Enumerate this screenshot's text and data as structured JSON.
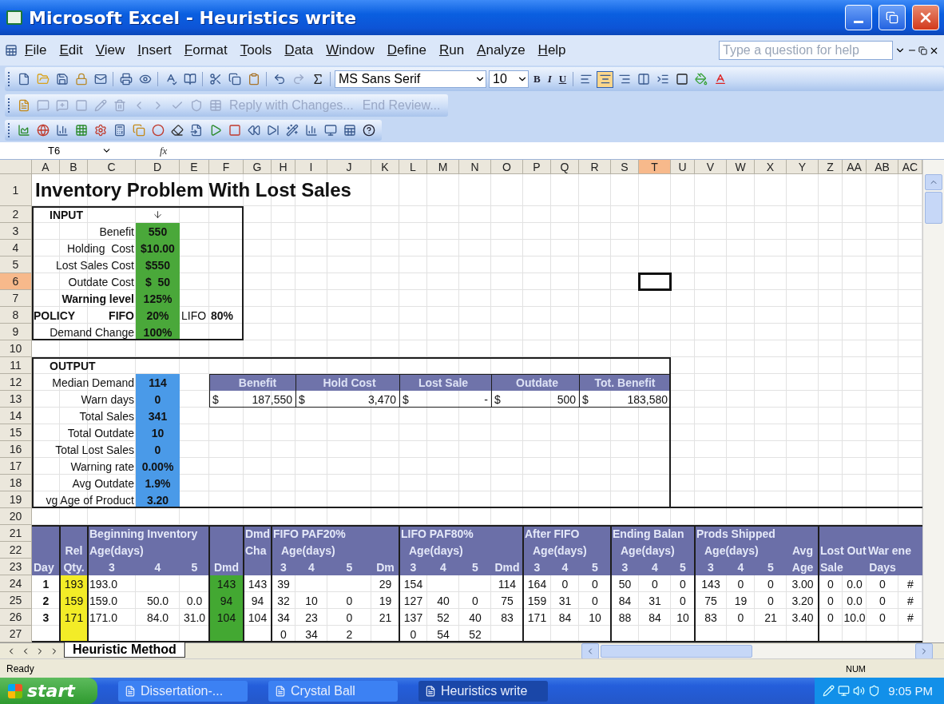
{
  "window": {
    "title": "Microsoft Excel - Heuristics write"
  },
  "menu": [
    "File",
    "Edit",
    "View",
    "Insert",
    "Format",
    "Tools",
    "Data",
    "Window",
    "Define",
    "Run",
    "Analyze",
    "Help"
  ],
  "help_box": {
    "placeholder": "Type a question for help"
  },
  "font_toolbar": {
    "font": "MS Sans Serif",
    "size": "10",
    "styles": [
      "B",
      "I",
      "U"
    ]
  },
  "review_toolbar": {
    "items": [
      "Reply with Changes...",
      "End Review..."
    ]
  },
  "formula_bar": {
    "cell": "T6",
    "function_label": "fx"
  },
  "columns": [
    {
      "label": "A",
      "selected": false
    },
    {
      "label": "B",
      "selected": false
    },
    {
      "label": "C",
      "selected": false
    },
    {
      "label": "D",
      "selected": false
    },
    {
      "label": "E",
      "selected": false
    },
    {
      "label": "F",
      "selected": false
    },
    {
      "label": "G",
      "selected": false
    },
    {
      "label": "H",
      "selected": false
    },
    {
      "label": "I",
      "selected": false
    },
    {
      "label": "J",
      "selected": false
    },
    {
      "label": "K",
      "selected": false
    },
    {
      "label": "L",
      "selected": false
    },
    {
      "label": "M",
      "selected": false
    },
    {
      "label": "N",
      "selected": false
    },
    {
      "label": "O",
      "selected": false
    },
    {
      "label": "P",
      "selected": false
    },
    {
      "label": "Q",
      "selected": false
    },
    {
      "label": "R",
      "selected": false
    },
    {
      "label": "S",
      "selected": false
    },
    {
      "label": "T",
      "selected": true
    },
    {
      "label": "U",
      "selected": false
    },
    {
      "label": "V",
      "selected": false
    },
    {
      "label": "W",
      "selected": false
    },
    {
      "label": "X",
      "selected": false
    },
    {
      "label": "Y",
      "selected": false
    },
    {
      "label": "Z",
      "selected": false
    },
    {
      "label": "AA",
      "selected": false
    },
    {
      "label": "AB",
      "selected": false
    },
    {
      "label": "AC",
      "selected": false
    }
  ],
  "rows": [
    {
      "label": "1",
      "selected": false,
      "kind": "plain",
      "cells": {
        "A": {
          "text": "Inventory Problem With Lost Sales",
          "kind": "title"
        }
      }
    },
    {
      "label": "2",
      "selected": false,
      "kind": "plain",
      "cells": {
        "A": {
          "text": "INPUT",
          "kind": "heading"
        },
        "D": {
          "kind": "marker"
        }
      }
    },
    {
      "label": "3",
      "selected": false,
      "kind": "plain",
      "cells": {
        "C": {
          "text": "Benefit",
          "kind": "label"
        },
        "D": {
          "text": "550",
          "kind": "input"
        }
      }
    },
    {
      "label": "4",
      "selected": false,
      "kind": "plain",
      "cells": {
        "C": {
          "text": "Holding  Cost",
          "kind": "label"
        },
        "D": {
          "text": "$10.00",
          "kind": "input"
        }
      }
    },
    {
      "label": "5",
      "selected": false,
      "kind": "plain",
      "cells": {
        "C": {
          "text": "Lost Sales Cost",
          "kind": "label"
        },
        "D": {
          "text": "$550",
          "kind": "input"
        }
      }
    },
    {
      "label": "6",
      "selected": true,
      "kind": "plain",
      "cells": {
        "C": {
          "text": "Outdate Cost",
          "kind": "label"
        },
        "D": {
          "text": "$  50",
          "kind": "input"
        }
      }
    },
    {
      "label": "7",
      "selected": false,
      "kind": "plain",
      "cells": {
        "C": {
          "text": "Warning level",
          "kind": "label-bold"
        },
        "D": {
          "text": "125%",
          "kind": "input"
        }
      }
    },
    {
      "label": "8",
      "selected": false,
      "kind": "plain",
      "cells": {
        "A": {
          "text": "POLICY",
          "kind": "policy"
        },
        "C": {
          "text": "FIFO",
          "kind": "label-bold"
        },
        "D": {
          "text": "20%",
          "kind": "input"
        },
        "E": {
          "text": "LIFO",
          "kind": "text"
        },
        "F": {
          "text": "80%",
          "kind": "bold"
        }
      }
    },
    {
      "label": "9",
      "selected": false,
      "kind": "plain",
      "cells": {
        "C": {
          "text": "Demand Change",
          "kind": "label"
        },
        "D": {
          "text": "100%",
          "kind": "input"
        }
      }
    },
    {
      "label": "10",
      "selected": false,
      "kind": "plain",
      "cells": {}
    },
    {
      "label": "11",
      "selected": false,
      "kind": "plain",
      "cells": {
        "A": {
          "text": "OUTPUT",
          "kind": "heading"
        }
      }
    },
    {
      "label": "12",
      "selected": false,
      "kind": "plain",
      "cells": {
        "C": {
          "text": "Median Demand",
          "kind": "label"
        },
        "D": {
          "text": "114",
          "kind": "output"
        },
        "G": {
          "text": "Benefit",
          "kind": "sum-head"
        },
        "J": {
          "text": "Hold Cost",
          "kind": "sum-head"
        },
        "M": {
          "text": "Lost Sale",
          "kind": "sum-head"
        },
        "P": {
          "text": "Outdate",
          "kind": "sum-head"
        },
        "S": {
          "text": "Tot. Benefit",
          "kind": "sum-head"
        }
      }
    },
    {
      "label": "13",
      "selected": false,
      "kind": "plain",
      "cells": {
        "C": {
          "text": "Warn days",
          "kind": "label"
        },
        "D": {
          "text": "0",
          "kind": "output"
        },
        "F": {
          "text": "$",
          "kind": "currency"
        },
        "H": {
          "text": "187,550",
          "kind": "amount"
        },
        "I": {
          "text": "$",
          "kind": "currency"
        },
        "K": {
          "text": "3,470",
          "kind": "amount"
        },
        "L": {
          "text": "$",
          "kind": "currency"
        },
        "N": {
          "text": "-",
          "kind": "amount"
        },
        "O": {
          "text": "$",
          "kind": "currency"
        },
        "Q": {
          "text": "500",
          "kind": "amount"
        },
        "R": {
          "text": "$",
          "kind": "currency"
        },
        "T": {
          "text": "183,580",
          "kind": "amount"
        }
      }
    },
    {
      "label": "14",
      "selected": false,
      "kind": "plain",
      "cells": {
        "C": {
          "text": "Total Sales",
          "kind": "label"
        },
        "D": {
          "text": "341",
          "kind": "output"
        }
      }
    },
    {
      "label": "15",
      "selected": false,
      "kind": "plain",
      "cells": {
        "C": {
          "text": "Total Outdate",
          "kind": "label"
        },
        "D": {
          "text": "10",
          "kind": "output"
        }
      }
    },
    {
      "label": "16",
      "selected": false,
      "kind": "plain",
      "cells": {
        "C": {
          "text": "Total Lost Sales",
          "kind": "label"
        },
        "D": {
          "text": "0",
          "kind": "output"
        }
      }
    },
    {
      "label": "17",
      "selected": false,
      "kind": "plain",
      "cells": {
        "C": {
          "text": "Warning rate",
          "kind": "label"
        },
        "D": {
          "text": "0.00%",
          "kind": "output"
        }
      }
    },
    {
      "label": "18",
      "selected": false,
      "kind": "plain",
      "cells": {
        "C": {
          "text": "Avg Outdate",
          "kind": "label"
        },
        "D": {
          "text": "1.9%",
          "kind": "output"
        }
      }
    },
    {
      "label": "19",
      "selected": false,
      "kind": "plain",
      "cells": {
        "C": {
          "text": "vg Age of Product",
          "kind": "label"
        },
        "D": {
          "text": "3.20",
          "kind": "output"
        }
      }
    },
    {
      "label": "20",
      "selected": false,
      "kind": "plain",
      "cells": {}
    },
    {
      "label": "21",
      "selected": false,
      "kind": "band",
      "cells": {
        "C": {
          "text": "Beginning Inventory",
          "kind": "head"
        },
        "G": {
          "text": "Dmd",
          "kind": "head"
        },
        "H": {
          "text": "FIFO PAF20%",
          "kind": "head"
        },
        "L": {
          "text": "LIFO PAF80%",
          "kind": "head"
        },
        "P": {
          "text": "After FIFO",
          "kind": "head"
        },
        "S": {
          "text": "Ending Balan",
          "kind": "head"
        },
        "V": {
          "text": "Prods Shipped",
          "kind": "head"
        }
      }
    },
    {
      "label": "22",
      "selected": false,
      "kind": "band",
      "cells": {
        "B": {
          "text": "Rel",
          "kind": "head-c"
        },
        "C": {
          "text": "Age(days)",
          "kind": "head"
        },
        "G": {
          "text": "Cha",
          "kind": "head"
        },
        "H": {
          "text": "Age(days)",
          "kind": "head-in"
        },
        "L": {
          "text": "Age(days)",
          "kind": "head-in"
        },
        "P": {
          "text": "Age(days)",
          "kind": "head-in"
        },
        "S": {
          "text": "Age(days)",
          "kind": "head-in"
        },
        "V": {
          "text": "Age(days)",
          "kind": "head-in"
        },
        "Y": {
          "text": "Avg",
          "kind": "head-c"
        },
        "Z": {
          "text": "Lost Out",
          "kind": "head"
        },
        "AB": {
          "text": "War ene",
          "kind": "head"
        }
      }
    },
    {
      "label": "23",
      "selected": false,
      "kind": "band",
      "cells": {
        "A": {
          "text": "Day",
          "kind": "head"
        },
        "B": {
          "text": "Qty.",
          "kind": "head-c"
        },
        "C": {
          "text": "3",
          "kind": "head-c"
        },
        "D": {
          "text": "4",
          "kind": "head-c"
        },
        "E": {
          "text": "5",
          "kind": "head-c"
        },
        "F": {
          "text": "Dmd",
          "kind": "head-c"
        },
        "H": {
          "text": "3",
          "kind": "head-c"
        },
        "I": {
          "text": "4",
          "kind": "head-c"
        },
        "J": {
          "text": "5",
          "kind": "head-c"
        },
        "K": {
          "text": "Dm",
          "kind": "head-c"
        },
        "L": {
          "text": "3",
          "kind": "head-c"
        },
        "M": {
          "text": "4",
          "kind": "head-c"
        },
        "N": {
          "text": "5",
          "kind": "head-c"
        },
        "O": {
          "text": "Dmd",
          "kind": "head-c"
        },
        "P": {
          "text": "3",
          "kind": "head-c"
        },
        "Q": {
          "text": "4",
          "kind": "head-c"
        },
        "R": {
          "text": "5",
          "kind": "head-c"
        },
        "S": {
          "text": "3",
          "kind": "head-c"
        },
        "T": {
          "text": "4",
          "kind": "head-c"
        },
        "U": {
          "text": "5",
          "kind": "head-c"
        },
        "V": {
          "text": "3",
          "kind": "head-c"
        },
        "W": {
          "text": "4",
          "kind": "head-c"
        },
        "X": {
          "text": "5",
          "kind": "head-c"
        },
        "Y": {
          "text": "Age",
          "kind": "head-c"
        },
        "Z": {
          "text": "Sale",
          "kind": "head"
        },
        "AB": {
          "text": "Days",
          "kind": "head-c"
        }
      }
    },
    {
      "label": "24",
      "selected": false,
      "kind": "plain",
      "cells": {
        "A": {
          "text": "1",
          "kind": "day"
        },
        "B": {
          "text": "193",
          "kind": "release"
        },
        "C": {
          "text": "193.0",
          "kind": "num-l"
        },
        "F": {
          "text": "143",
          "kind": "demand"
        },
        "G": {
          "text": "143",
          "kind": "num"
        },
        "H": {
          "text": "39",
          "kind": "num"
        },
        "K": {
          "text": "29",
          "kind": "num"
        },
        "L": {
          "text": "154",
          "kind": "num"
        },
        "O": {
          "text": "114",
          "kind": "num"
        },
        "P": {
          "text": "164",
          "kind": "num"
        },
        "Q": {
          "text": "0",
          "kind": "num"
        },
        "R": {
          "text": "0",
          "kind": "num"
        },
        "S": {
          "text": "50",
          "kind": "num"
        },
        "T": {
          "text": "0",
          "kind": "num"
        },
        "U": {
          "text": "0",
          "kind": "num"
        },
        "V": {
          "text": "143",
          "kind": "num"
        },
        "W": {
          "text": "0",
          "kind": "num"
        },
        "X": {
          "text": "0",
          "kind": "num"
        },
        "Y": {
          "text": "3.00",
          "kind": "num"
        },
        "Z": {
          "text": "0",
          "kind": "num"
        },
        "AA": {
          "text": "0.0",
          "kind": "num"
        },
        "AB": {
          "text": "0",
          "kind": "num"
        },
        "AC": {
          "text": "#",
          "kind": "num"
        }
      }
    },
    {
      "label": "25",
      "selected": false,
      "kind": "plain",
      "cells": {
        "A": {
          "text": "2",
          "kind": "day"
        },
        "B": {
          "text": "159",
          "kind": "release"
        },
        "C": {
          "text": "159.0",
          "kind": "num-l"
        },
        "D": {
          "text": "50.0",
          "kind": "num"
        },
        "E": {
          "text": "0.0",
          "kind": "num"
        },
        "F": {
          "text": "94",
          "kind": "demand"
        },
        "G": {
          "text": "94",
          "kind": "num"
        },
        "H": {
          "text": "32",
          "kind": "num"
        },
        "I": {
          "text": "10",
          "kind": "num"
        },
        "J": {
          "text": "0",
          "kind": "num"
        },
        "K": {
          "text": "19",
          "kind": "num"
        },
        "L": {
          "text": "127",
          "kind": "num"
        },
        "M": {
          "text": "40",
          "kind": "num"
        },
        "N": {
          "text": "0",
          "kind": "num"
        },
        "O": {
          "text": "75",
          "kind": "num"
        },
        "P": {
          "text": "159",
          "kind": "num"
        },
        "Q": {
          "text": "31",
          "kind": "num"
        },
        "R": {
          "text": "0",
          "kind": "num"
        },
        "S": {
          "text": "84",
          "kind": "num"
        },
        "T": {
          "text": "31",
          "kind": "num"
        },
        "U": {
          "text": "0",
          "kind": "num"
        },
        "V": {
          "text": "75",
          "kind": "num"
        },
        "W": {
          "text": "19",
          "kind": "num"
        },
        "X": {
          "text": "0",
          "kind": "num"
        },
        "Y": {
          "text": "3.20",
          "kind": "num"
        },
        "Z": {
          "text": "0",
          "kind": "num"
        },
        "AA": {
          "text": "0.0",
          "kind": "num"
        },
        "AB": {
          "text": "0",
          "kind": "num"
        },
        "AC": {
          "text": "#",
          "kind": "num"
        }
      }
    },
    {
      "label": "26",
      "selected": false,
      "kind": "plain",
      "cells": {
        "A": {
          "text": "3",
          "kind": "day"
        },
        "B": {
          "text": "171",
          "kind": "release"
        },
        "C": {
          "text": "171.0",
          "kind": "num-l"
        },
        "D": {
          "text": "84.0",
          "kind": "num"
        },
        "E": {
          "text": "31.0",
          "kind": "num"
        },
        "F": {
          "text": "104",
          "kind": "demand"
        },
        "G": {
          "text": "104",
          "kind": "num"
        },
        "H": {
          "text": "34",
          "kind": "num"
        },
        "I": {
          "text": "23",
          "kind": "num"
        },
        "J": {
          "text": "0",
          "kind": "num"
        },
        "K": {
          "text": "21",
          "kind": "num"
        },
        "L": {
          "text": "137",
          "kind": "num"
        },
        "M": {
          "text": "52",
          "kind": "num"
        },
        "N": {
          "text": "40",
          "kind": "num"
        },
        "O": {
          "text": "83",
          "kind": "num"
        },
        "P": {
          "text": "171",
          "kind": "num"
        },
        "Q": {
          "text": "84",
          "kind": "num"
        },
        "R": {
          "text": "10",
          "kind": "num"
        },
        "S": {
          "text": "88",
          "kind": "num"
        },
        "T": {
          "text": "84",
          "kind": "num"
        },
        "U": {
          "text": "10",
          "kind": "num"
        },
        "V": {
          "text": "83",
          "kind": "num"
        },
        "W": {
          "text": "0",
          "kind": "num"
        },
        "X": {
          "text": "21",
          "kind": "num"
        },
        "Y": {
          "text": "3.40",
          "kind": "num"
        },
        "Z": {
          "text": "0",
          "kind": "num"
        },
        "AA": {
          "text": "10.0",
          "kind": "num"
        },
        "AB": {
          "text": "0",
          "kind": "num"
        },
        "AC": {
          "text": "#",
          "kind": "num"
        }
      }
    },
    {
      "label": "27",
      "selected": false,
      "kind": "plain",
      "cells": {
        "B": {
          "kind": "release"
        },
        "F": {
          "kind": "demand"
        },
        "H": {
          "text": "0",
          "kind": "num"
        },
        "I": {
          "text": "34",
          "kind": "num"
        },
        "J": {
          "text": "2",
          "kind": "num"
        },
        "L": {
          "text": "0",
          "kind": "num"
        },
        "M": {
          "text": "54",
          "kind": "num"
        },
        "N": {
          "text": "52",
          "kind": "num"
        }
      }
    }
  ],
  "sheet_tabs": [
    {
      "label": "Heuristic Method",
      "selected": true
    }
  ],
  "status_bar": {
    "state": "Ready",
    "indicator": "NUM"
  },
  "taskbar": {
    "start": "start",
    "tasks": [
      {
        "label": "Dissertation-...",
        "selected": false
      },
      {
        "label": "Crystal Ball",
        "selected": false
      },
      {
        "label": "Heuristics write",
        "selected": true
      }
    ],
    "clock": "9:05 PM"
  }
}
